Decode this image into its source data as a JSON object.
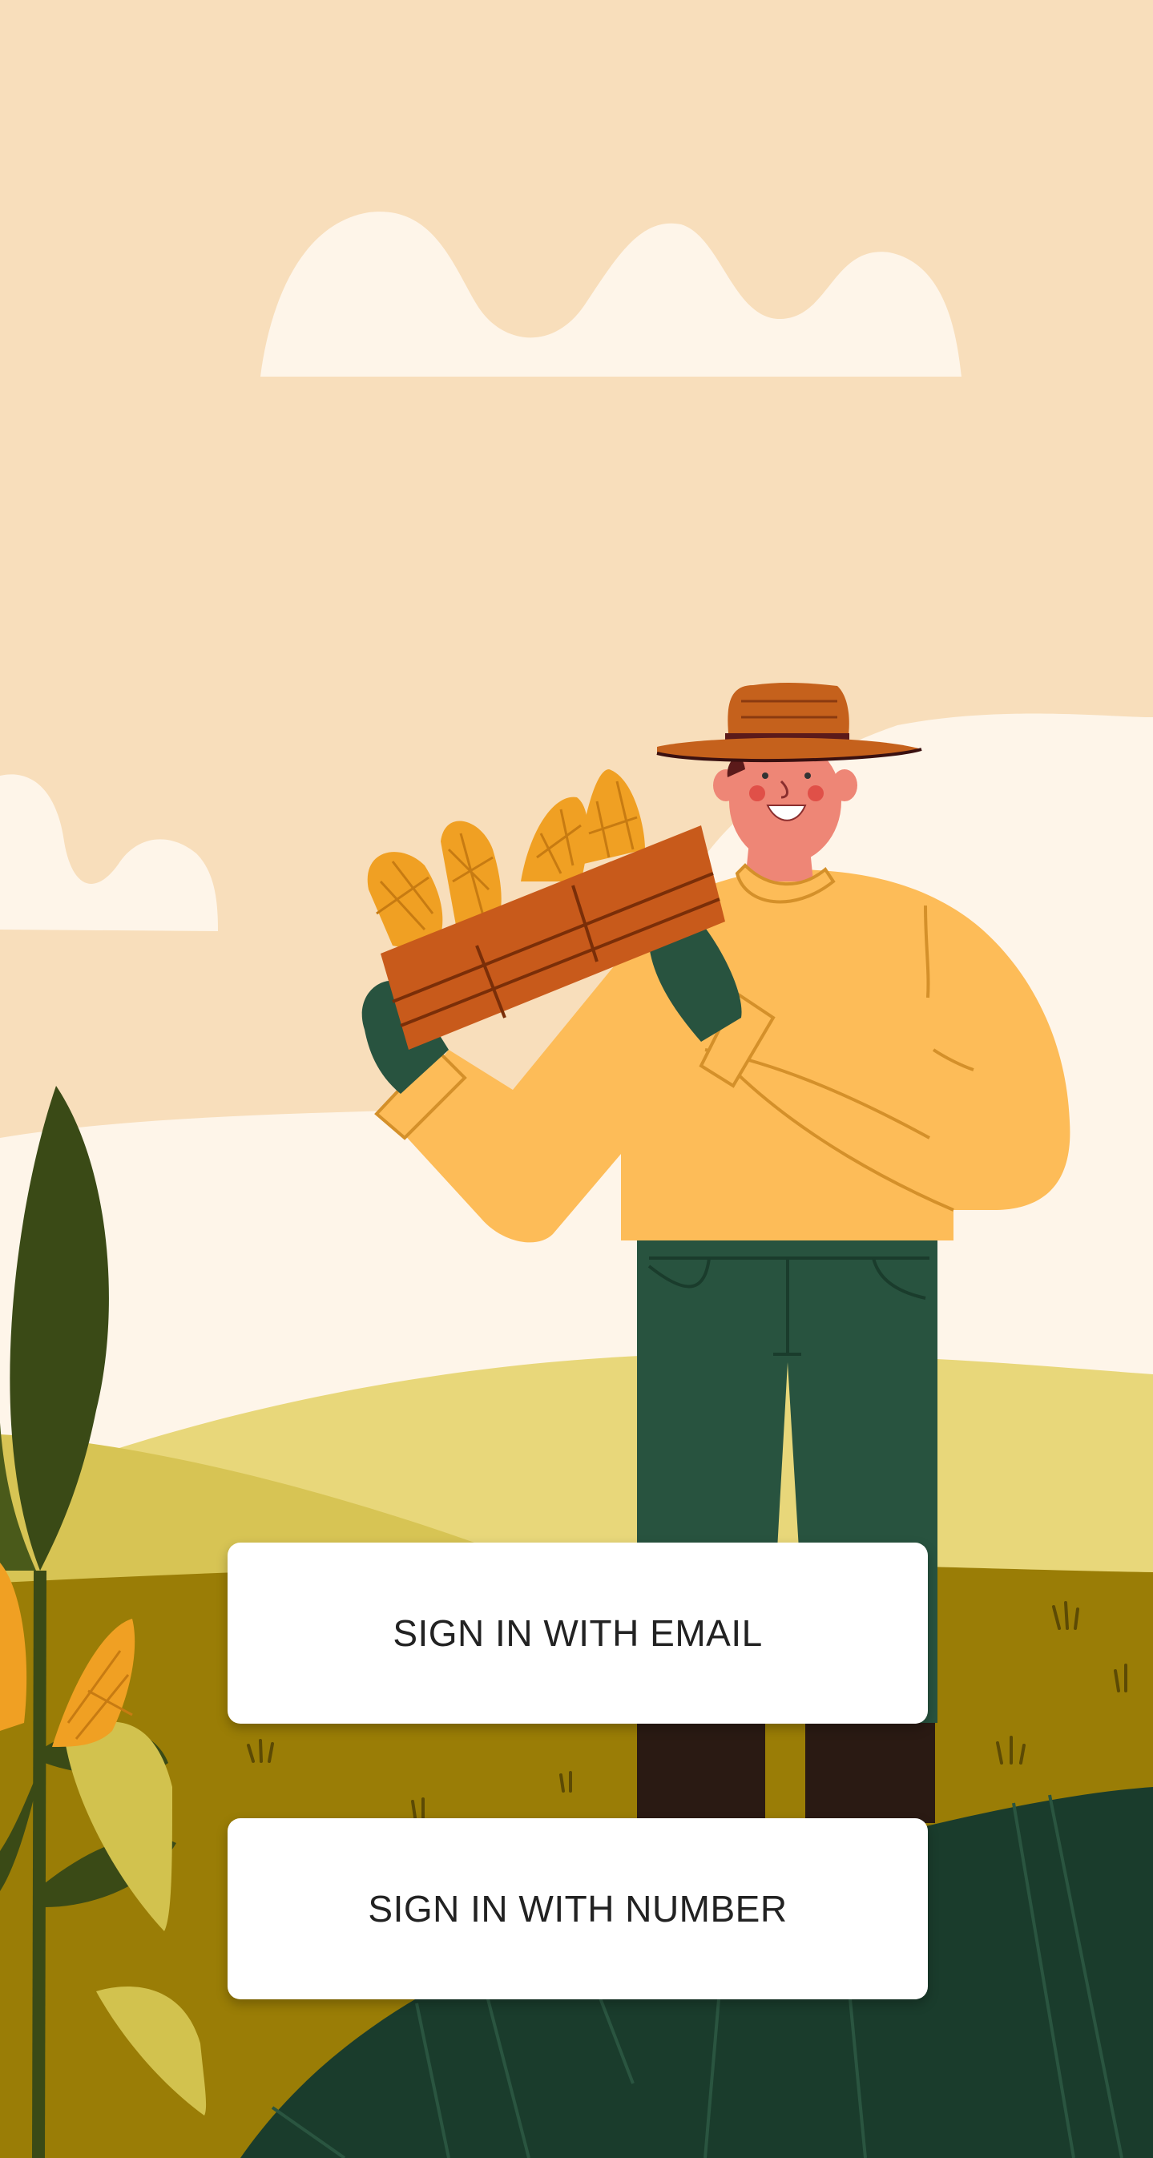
{
  "colors": {
    "sky": "#F8DEBB",
    "cloud": "#FEF5E9",
    "far_hill": "#E8D77A",
    "mid_hill": "#D7C454",
    "field": "#9A7D06",
    "dark_hill": "#1A3C2C",
    "shirt": "#FDBC58",
    "pants": "#28533F",
    "boots": "#2A1A13",
    "hat": "#C5611C",
    "hat_band": "#5B1A1A",
    "skin": "#EE8676",
    "crate": "#C85A1B",
    "corn": "#F0A023",
    "glove": "#28533F",
    "corn_leaf": "#3A4A16",
    "button_bg": "#FFFFFF",
    "button_text": "#222222"
  },
  "illustration": {
    "name": "farmer-holding-corn-crate"
  },
  "actions": {
    "email_label": "SIGN IN WITH EMAIL",
    "number_label": "SIGN IN WITH NUMBER"
  }
}
